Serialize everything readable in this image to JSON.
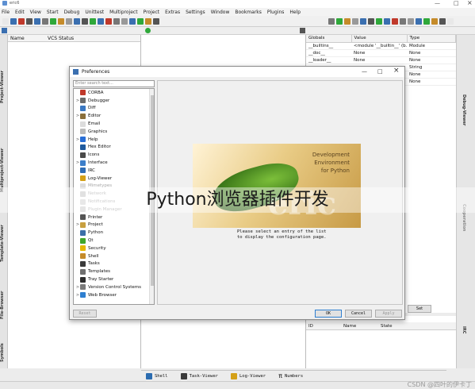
{
  "window": {
    "title": "eric6"
  },
  "menu": [
    "File",
    "Edit",
    "View",
    "Start",
    "Debug",
    "Unittest",
    "Multiproject",
    "Project",
    "Extras",
    "Settings",
    "Window",
    "Bookmarks",
    "Plugins",
    "Help"
  ],
  "left_tabs": [
    "Project-Viewer",
    "Multiproject-Viewer",
    "Template-Viewer",
    "File-Browser",
    "Symbols"
  ],
  "project_panel": {
    "col_name": "Name",
    "col_vcs": "VCS Status"
  },
  "globals": {
    "headers": [
      "Globals",
      "Value",
      "Type"
    ],
    "rows": [
      [
        "__builtins__",
        "<module '__builtin__' (b...",
        "Module"
      ],
      [
        "__doc__",
        "None",
        "None"
      ],
      [
        "__loader__",
        "None",
        "None"
      ],
      [
        "",
        "",
        "String"
      ],
      [
        "",
        "",
        "None"
      ],
      [
        "",
        "",
        "None"
      ]
    ]
  },
  "right_tabs": [
    "Debug-Viewer",
    "Cooperation",
    "IRC"
  ],
  "right_bottom": {
    "set_button": "Set",
    "headers": [
      "ID",
      "Name",
      "State"
    ]
  },
  "bottom_tabs": [
    "Shell",
    "Task-Viewer",
    "Log-Viewer",
    "Numbers"
  ],
  "dialog": {
    "title": "Preferences",
    "search_placeholder": "Enter search text...",
    "items": [
      {
        "label": "CORBA",
        "arrow": "",
        "disabled": false,
        "icon_color": "#c0392b"
      },
      {
        "label": "Debugger",
        "arrow": ">",
        "disabled": false,
        "icon_color": "#6c6c6c"
      },
      {
        "label": "Diff",
        "arrow": "",
        "disabled": false,
        "icon_color": "#3a78c2"
      },
      {
        "label": "Editor",
        "arrow": ">",
        "disabled": false,
        "icon_color": "#8a6f3a"
      },
      {
        "label": "Email",
        "arrow": "",
        "disabled": false,
        "icon_color": "#dcdcdc"
      },
      {
        "label": "Graphics",
        "arrow": "",
        "disabled": false,
        "icon_color": "#bcbcbc"
      },
      {
        "label": "Help",
        "arrow": ">",
        "disabled": false,
        "icon_color": "#2a6fd6"
      },
      {
        "label": "Hex Editor",
        "arrow": "",
        "disabled": false,
        "icon_color": "#1f5a9e"
      },
      {
        "label": "Icons",
        "arrow": "",
        "disabled": false,
        "icon_color": "#4a4a4a"
      },
      {
        "label": "Interface",
        "arrow": ">",
        "disabled": false,
        "icon_color": "#3c7ec9"
      },
      {
        "label": "IRC",
        "arrow": "",
        "disabled": false,
        "icon_color": "#2f6db5"
      },
      {
        "label": "Log-Viewer",
        "arrow": "",
        "disabled": false,
        "icon_color": "#d4a017"
      },
      {
        "label": "Mimetypes",
        "arrow": "",
        "disabled": true,
        "icon_color": "#dcdcdc"
      },
      {
        "label": "Network",
        "arrow": "",
        "disabled": true,
        "icon_color": "#c9c9c9"
      },
      {
        "label": "Notifications",
        "arrow": "",
        "disabled": true,
        "icon_color": "#d6d6d6"
      },
      {
        "label": "Plugin Manager",
        "arrow": "",
        "disabled": true,
        "icon_color": "#d0d0d0"
      },
      {
        "label": "Printer",
        "arrow": "",
        "disabled": false,
        "icon_color": "#555555"
      },
      {
        "label": "Project",
        "arrow": ">",
        "disabled": false,
        "icon_color": "#c8a040"
      },
      {
        "label": "Python",
        "arrow": "",
        "disabled": false,
        "icon_color": "#3b6ea8"
      },
      {
        "label": "Qt",
        "arrow": "",
        "disabled": false,
        "icon_color": "#41a62a"
      },
      {
        "label": "Security",
        "arrow": "",
        "disabled": false,
        "icon_color": "#e6b800"
      },
      {
        "label": "Shell",
        "arrow": "",
        "disabled": false,
        "icon_color": "#c58b2a"
      },
      {
        "label": "Tasks",
        "arrow": "",
        "disabled": false,
        "icon_color": "#3a3a3a"
      },
      {
        "label": "Templates",
        "arrow": "",
        "disabled": false,
        "icon_color": "#6f6f6f"
      },
      {
        "label": "Tray Starter",
        "arrow": "",
        "disabled": false,
        "icon_color": "#2d2d2d"
      },
      {
        "label": "Version Control Systems",
        "arrow": ">",
        "disabled": false,
        "icon_color": "#7a7a7a"
      },
      {
        "label": "Web Browser",
        "arrow": ">",
        "disabled": false,
        "icon_color": "#2f7fd0"
      }
    ],
    "splash_brand_line1": "Development Environment",
    "splash_brand_line2": "for Python",
    "splash_logo": "eric",
    "message_line1": "Please select an entry of the list",
    "message_line2": "to display the configuration page.",
    "reset_label": "Reset",
    "ok_label": "OK",
    "cancel_label": "Cancel",
    "apply_label": "Apply",
    "minimize": "—",
    "maximize": "□",
    "close": "×"
  },
  "overlay_title": "Python浏览器插件开发",
  "watermark": "CSDN @四叶的伊卡丁"
}
